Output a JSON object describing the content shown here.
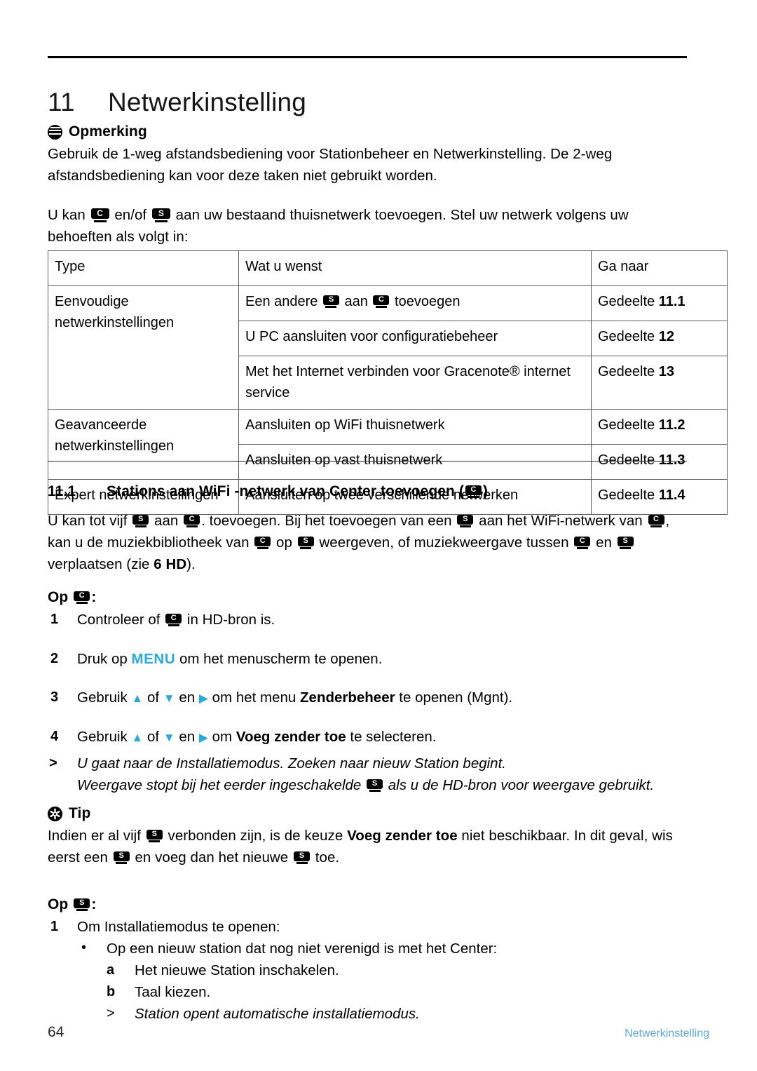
{
  "page": {
    "chapter_number": "11",
    "chapter_title": "Netwerkinstelling",
    "footer_page_number": "64",
    "footer_chapter": "Netwerkinstelling",
    "accent_blue": "#27a9e1",
    "footer_blue": "#5aa9e6"
  },
  "note": {
    "icon": "note-icon",
    "heading": "Opmerking",
    "body": "Gebruik de 1-weg afstandsbediening voor Stationbeheer en Netwerkinstelling. De 2-weg afstandsbediening kan voor deze taken niet gebruikt worden."
  },
  "intro": {
    "part1": "U kan",
    "icon1": "C",
    "part2": "en/of",
    "icon2": "S",
    "part3": "aan uw bestaand thuisnetwerk toevoegen. Stel uw netwerk volgens uw behoeften als volgt in:"
  },
  "table": {
    "headers": [
      "Type",
      "Wat u wenst",
      "Ga naar"
    ],
    "rows": [
      {
        "type": "Eenvoudige netwerkinstellingen",
        "items": [
          {
            "want_pre": "Een andere",
            "want_icon1": "S",
            "want_mid": "aan",
            "want_icon2": "C",
            "want_post": "toevoegen",
            "goto_label": "Gedeelte",
            "goto_num": "11.1"
          },
          {
            "want": "U PC aansluiten voor configuratiebeheer",
            "goto_label": "Gedeelte",
            "goto_num": "12"
          },
          {
            "want": "Met het Internet verbinden voor Gracenote® internet service",
            "goto_label": "Gedeelte",
            "goto_num": "13"
          }
        ]
      },
      {
        "type": "Geavanceerde netwerkinstellingen",
        "items": [
          {
            "want": "Aansluiten op WiFi thuisnetwerk",
            "goto_label": "Gedeelte",
            "goto_num": "11.2"
          },
          {
            "want": "Aansluiten op vast thuisnetwerk",
            "goto_label": "Gedeelte",
            "goto_num": "11.3"
          }
        ]
      },
      {
        "type": "Expert netwerkinstellingen",
        "items": [
          {
            "want": "Aansluiten op twee verschillende netwerken",
            "goto_label": "Gedeelte",
            "goto_num": "11.4"
          }
        ]
      }
    ]
  },
  "section": {
    "number": "11.1",
    "title_pre": "Stations aan WiFi -netwerk van Center toevoegen (",
    "title_icon": "C",
    "title_post": ")",
    "para": {
      "s1": "U kan tot vijf",
      "i1": "S",
      "s2": "aan",
      "i2": "C",
      "s3": ". toevoegen. Bij het toevoegen van een",
      "i3": "S",
      "s4": "aan het WiFi-netwerk van",
      "i4": "C",
      "s5": ", kan u de muziekbibliotheek van",
      "i5": "C",
      "s6": "op",
      "i6": "S",
      "s7": "weergeven, of muziekweergave tussen",
      "i7": "C",
      "s8": "en",
      "i8": "S",
      "s9": "verplaatsen (zie",
      "s9b": "6 HD",
      "s10": ")."
    }
  },
  "op_center": {
    "heading_pre": "Op",
    "heading_icon": "C",
    "heading_post": ":",
    "steps": [
      {
        "num": "1",
        "pre": "Controleer of",
        "icon": "C",
        "post": "in HD-bron is."
      },
      {
        "num": "2",
        "pre": "Druk op",
        "keyword": "MENU",
        "post": "om het menuscherm te openen."
      },
      {
        "num": "3",
        "pre": "Gebruik",
        "arrow_up": "▲",
        "of": "of",
        "arrow_down": "▼",
        "en": "en",
        "arrow_right": "▶",
        "mid": "om het menu",
        "bold": "Zenderbeheer",
        "post": "te openen (Mgnt)."
      },
      {
        "num": "4",
        "pre": "Gebruik",
        "arrow_up": "▲",
        "of": "of",
        "arrow_down": "▼",
        "en": "en",
        "arrow_right": "▶",
        "mid": "om",
        "bold": "Voeg zender toe",
        "post": "te selecteren."
      }
    ],
    "results": [
      {
        "marker": ">",
        "text": "U gaat naar de Installatiemodus. Zoeken naar nieuw Station begint."
      },
      {
        "marker": "",
        "pre": "Weergave stopt bij het eerder ingeschakelde",
        "icon": "S",
        "post": "als u de HD-bron voor weergave gebruikt."
      }
    ]
  },
  "tip": {
    "icon": "tip-icon",
    "heading": "Tip",
    "pre": "Indien er al vijf",
    "i1": "S",
    "mid1": "verbonden zijn, is de keuze",
    "bold": "Voeg zender toe",
    "mid2": "niet beschikbaar. In dit geval, wis eerst een",
    "i2": "S",
    "mid3": "en voeg dan het nieuwe",
    "i3": "S",
    "post": "toe."
  },
  "op_station": {
    "heading_pre": "Op",
    "heading_icon": "S",
    "heading_post": ":",
    "step1": {
      "num": "1",
      "text": "Om Installatiemodus te openen:"
    },
    "bullet": {
      "marker": "•",
      "text": "Op een nieuw station dat nog niet verenigd is met het Center:"
    },
    "sub": [
      {
        "marker": "a",
        "text": "Het nieuwe Station inschakelen."
      },
      {
        "marker": "b",
        "text": "Taal kiezen."
      }
    ],
    "result": {
      "marker": ">",
      "text": "Station opent automatische installatiemodus."
    }
  }
}
